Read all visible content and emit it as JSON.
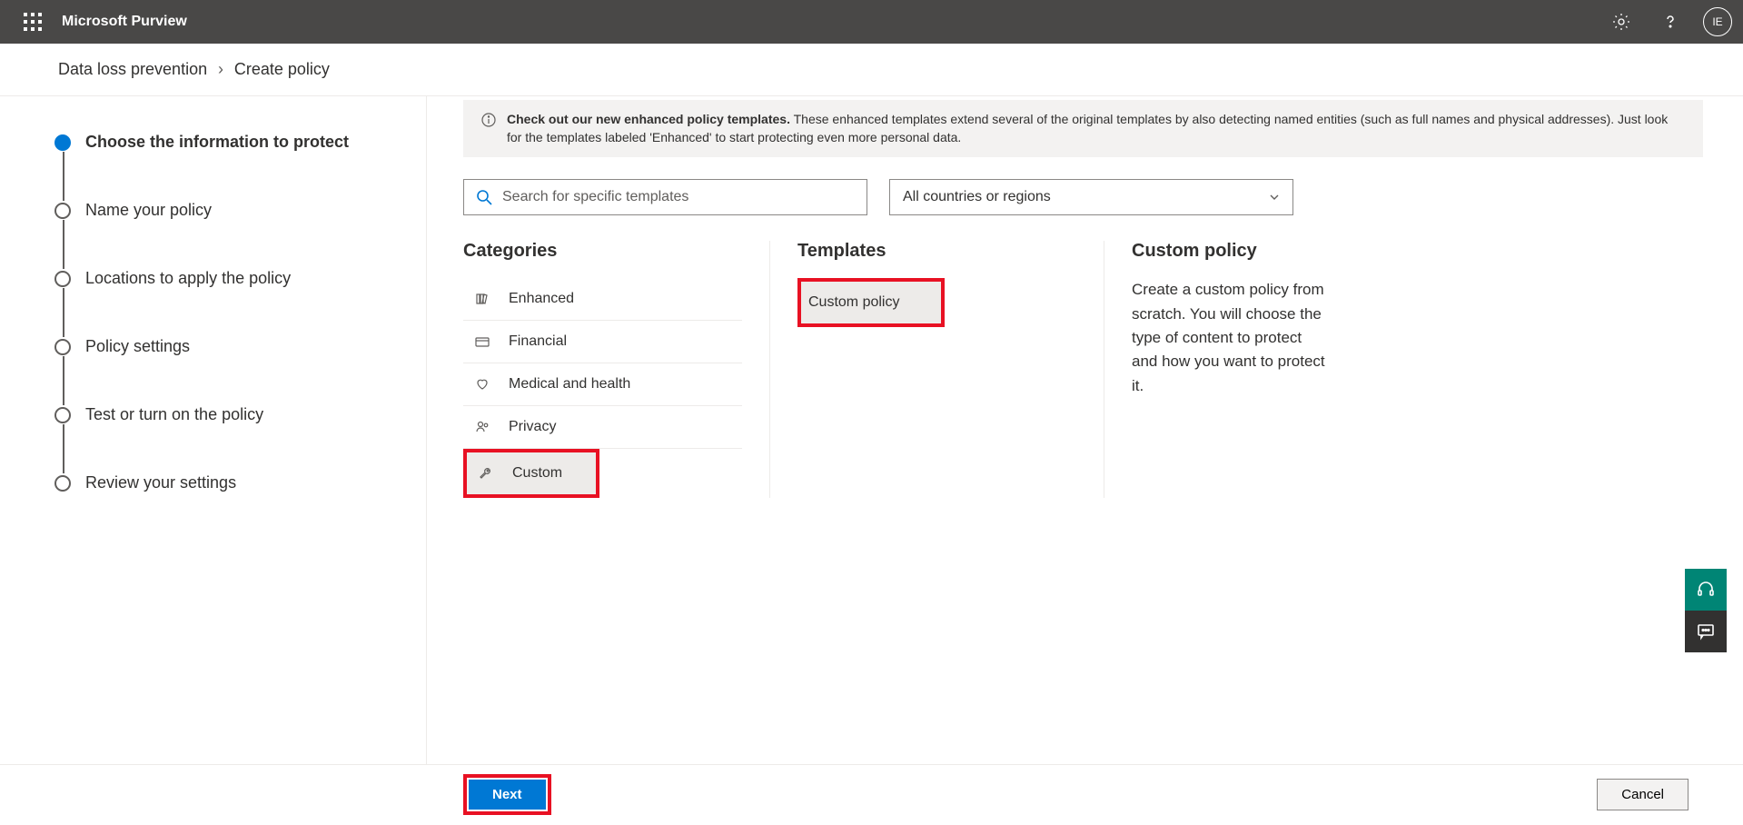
{
  "header": {
    "app_title": "Microsoft Purview",
    "avatar_initials": "IE"
  },
  "breadcrumb": {
    "item1": "Data loss prevention",
    "item2": "Create policy"
  },
  "stepper": {
    "steps": [
      "Choose the information to protect",
      "Name your policy",
      "Locations to apply the policy",
      "Policy settings",
      "Test or turn on the policy",
      "Review your settings"
    ]
  },
  "banner": {
    "bold": "Check out our new enhanced policy templates.",
    "rest": " These enhanced templates extend several of the original templates by also detecting named entities (such as full names and physical addresses). Just look for the templates labeled 'Enhanced' to start protecting even more personal data."
  },
  "search": {
    "placeholder": "Search for specific templates"
  },
  "dropdown": {
    "selected": "All countries or regions"
  },
  "columns": {
    "categories_heading": "Categories",
    "templates_heading": "Templates",
    "categories": [
      "Enhanced",
      "Financial",
      "Medical and health",
      "Privacy",
      "Custom"
    ],
    "templates": [
      "Custom policy"
    ],
    "detail_title": "Custom policy",
    "detail_body": "Create a custom policy from scratch. You will choose the type of content to protect and how you want to protect it."
  },
  "footer": {
    "next_label": "Next",
    "cancel_label": "Cancel"
  }
}
